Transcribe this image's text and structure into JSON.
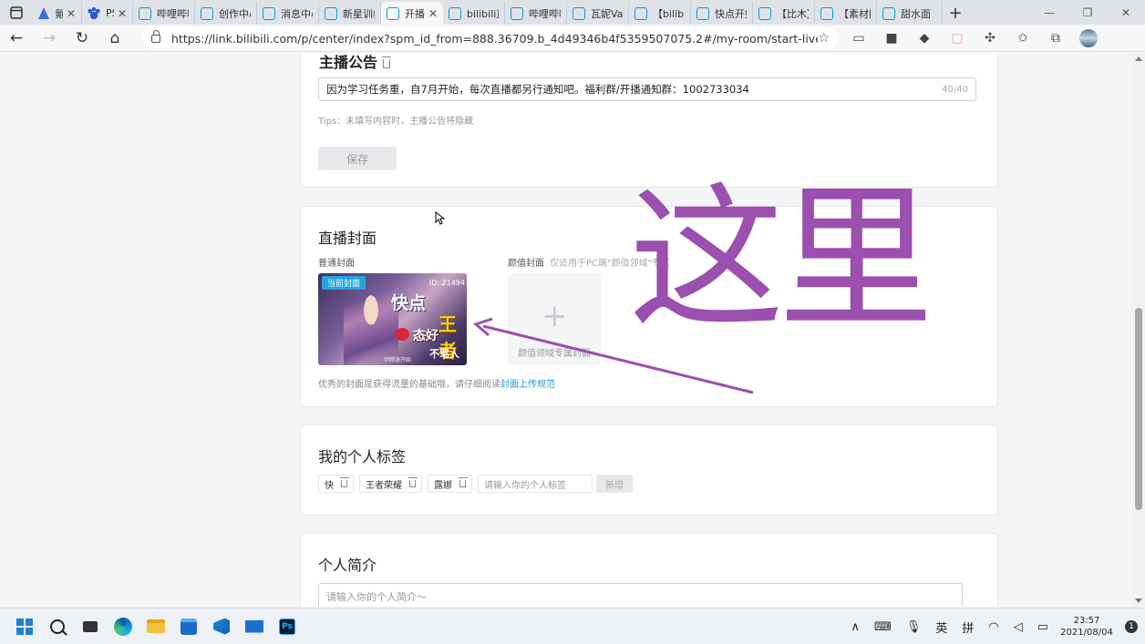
{
  "browser": {
    "tabs": [
      {
        "label": "氪",
        "icon": "nav-arrow-icon"
      },
      {
        "label": "PS_",
        "icon": "paw-icon"
      },
      {
        "label": "哔哩哔哩",
        "icon": "bilibili-tv-icon"
      },
      {
        "label": "创作中心",
        "icon": "bilibili-tv-icon"
      },
      {
        "label": "消息中心",
        "icon": "bilibili-tv-icon"
      },
      {
        "label": "新星训练",
        "icon": "bilibili-tv-icon"
      },
      {
        "label": "开播",
        "icon": "bilibili-tv-icon",
        "active": true
      },
      {
        "label": "bilibili直",
        "icon": "bilibili-tv-icon"
      },
      {
        "label": "哔哩哔哩",
        "icon": "bilibili-tv-icon"
      },
      {
        "label": "瓦妮Vane",
        "icon": "bilibili-tv-icon"
      },
      {
        "label": "【bilibili",
        "icon": "bilibili-tv-icon"
      },
      {
        "label": "快点开始",
        "icon": "bilibili-tv-icon"
      },
      {
        "label": "【比木】",
        "icon": "bilibili-tv-icon"
      },
      {
        "label": "【素材网",
        "icon": "bilibili-tv-icon"
      },
      {
        "label": "甜水面",
        "icon": "bilibili-tv-icon"
      }
    ],
    "new_tab": "+",
    "url": "https://link.bilibili.com/p/center/index?spm_id_from=888.36709.b_4d49346b4f5359507075.2#/my-room/start-live"
  },
  "announcement": {
    "title": "主播公告",
    "value": "因为学习任务重，自7月开始，每次直播都另行通知吧。福利群/开播通知群：1002733034",
    "counter": "40/40",
    "tips": "Tips：未填写内容时，主播公告将隐藏",
    "save_label": "保存"
  },
  "cover": {
    "title": "直播封面",
    "normal_label": "普通封面",
    "beauty_label": "颜值封面",
    "beauty_hint": "仅适用于PC端\"颜值领域\"专区",
    "current_badge": "当前封面",
    "cover_id": "ID: 21494",
    "cover_texts": [
      "快点",
      "王者",
      "态好",
      "不骂人",
      "伊腾洛开始"
    ],
    "plus": "+",
    "upload_label": "颜值领域专属封面",
    "tip_prefix": "优秀的封面是获得流量的基础哦，请仔细阅读",
    "tip_link": "封面上传规范"
  },
  "tags": {
    "title": "我的个人标签",
    "items": [
      "快",
      "王者荣耀",
      "露娜"
    ],
    "input_placeholder": "请输入你的个人标签",
    "add_label": "新增"
  },
  "bio": {
    "title": "个人简介",
    "placeholder": "请输入你的个人简介～"
  },
  "annotation": {
    "text": "这里",
    "color": "#9b4fae"
  },
  "taskbar": {
    "tray_ime_1": "英",
    "tray_ime_2": "拼",
    "time": "23:57",
    "date": "2021/08/04",
    "notif_count": "1"
  }
}
